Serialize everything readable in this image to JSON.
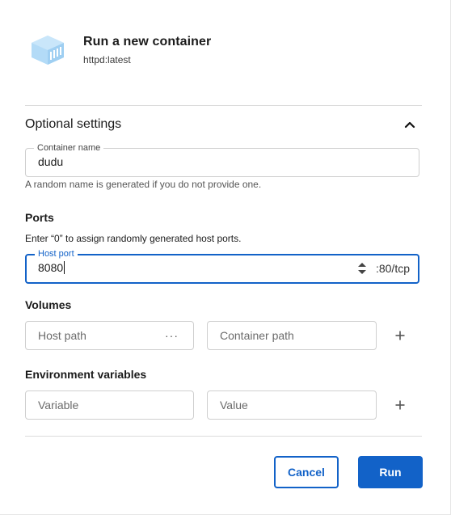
{
  "header": {
    "title": "Run a new container",
    "image": "httpd:latest",
    "icon": "container-box-icon"
  },
  "optional_settings": {
    "title": "Optional settings",
    "expanded": true,
    "container_name": {
      "label": "Container name",
      "value": "dudu",
      "helper": "A random name is generated if you do not provide one."
    },
    "ports": {
      "title": "Ports",
      "hint": "Enter “0” to assign randomly generated host ports.",
      "host_port_label": "Host port",
      "host_port_value": "8080",
      "container_port_suffix": ":80/tcp"
    },
    "volumes": {
      "title": "Volumes",
      "host_path_placeholder": "Host path",
      "host_path_more": "···",
      "container_path_placeholder": "Container path"
    },
    "env": {
      "title": "Environment variables",
      "variable_placeholder": "Variable",
      "value_placeholder": "Value"
    }
  },
  "actions": {
    "cancel_label": "Cancel",
    "run_label": "Run"
  },
  "colors": {
    "accent": "#1262c8",
    "icon_light": "#a9d5f5",
    "icon_mid": "#8cc6ef"
  }
}
